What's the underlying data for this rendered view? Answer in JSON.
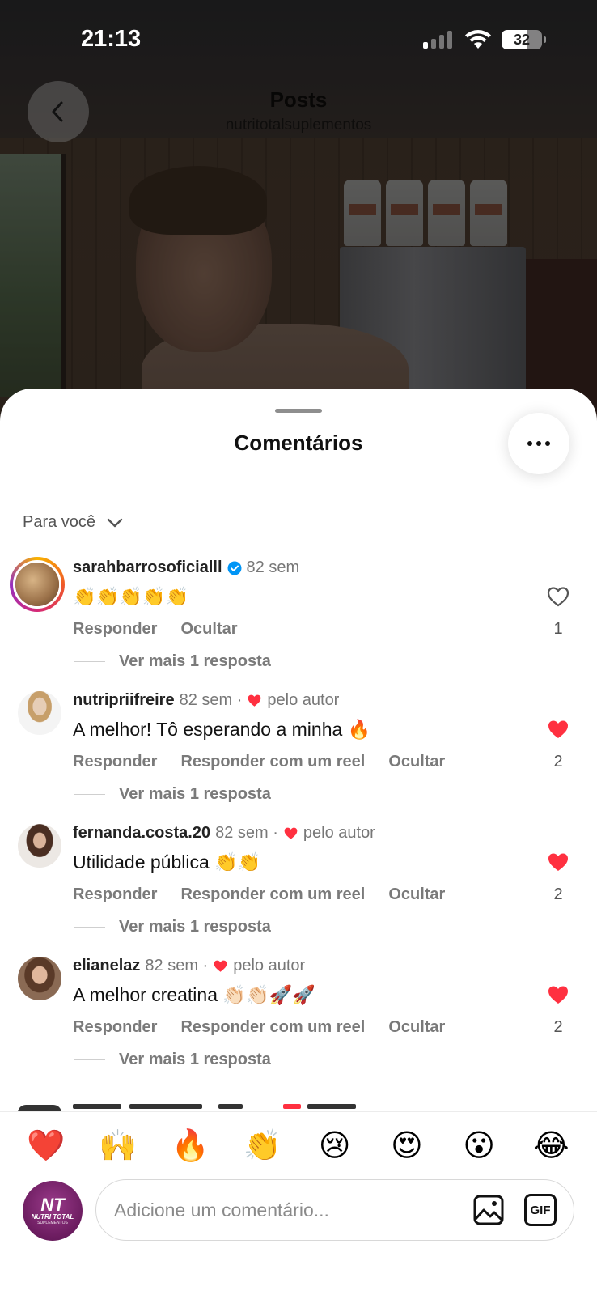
{
  "status_bar": {
    "time": "21:13",
    "battery": "32"
  },
  "header": {
    "title": "Posts",
    "subtitle": "nutritotalsuplementos"
  },
  "sheet": {
    "title": "Comentários",
    "filter": "Para você"
  },
  "comments": [
    {
      "user": "sarahbarrosoficialll",
      "verified": true,
      "age": "82 sem",
      "text": "👏👏👏👏👏",
      "liked": false,
      "likes": "1",
      "actions": [
        "Responder",
        "Ocultar"
      ],
      "replies": "Ver mais 1 resposta"
    },
    {
      "user": "nutripriifreire",
      "age": "82 sem ·",
      "author_badge": "pelo autor",
      "text": "A melhor! Tô esperando a minha 🔥",
      "liked": true,
      "likes": "2",
      "actions": [
        "Responder",
        "Responder com um reel",
        "Ocultar"
      ],
      "replies": "Ver mais 1 resposta"
    },
    {
      "user": "fernanda.costa.20",
      "age": "82 sem ·",
      "author_badge": "pelo autor",
      "text": "Utilidade pública 👏👏",
      "liked": true,
      "likes": "2",
      "actions": [
        "Responder",
        "Responder com um reel",
        "Ocultar"
      ],
      "replies": "Ver mais 1 resposta"
    },
    {
      "user": "elianelaz",
      "age": "82 sem ·",
      "author_badge": "pelo autor",
      "text": "A melhor creatina 👏🏻👏🏻🚀🚀",
      "liked": true,
      "likes": "2",
      "actions": [
        "Responder",
        "Responder com um reel",
        "Ocultar"
      ],
      "replies": "Ver mais 1 resposta"
    }
  ],
  "emoji_bar": [
    "❤️",
    "🙌",
    "🔥",
    "👏",
    "😢",
    "😍",
    "😮",
    "😂"
  ],
  "composer": {
    "placeholder": "Adicione um comentário...",
    "avatar_logo": "NT",
    "gif_label": "GIF"
  },
  "colors": {
    "like_red": "#ff3040",
    "verified_blue": "#0095f6"
  }
}
